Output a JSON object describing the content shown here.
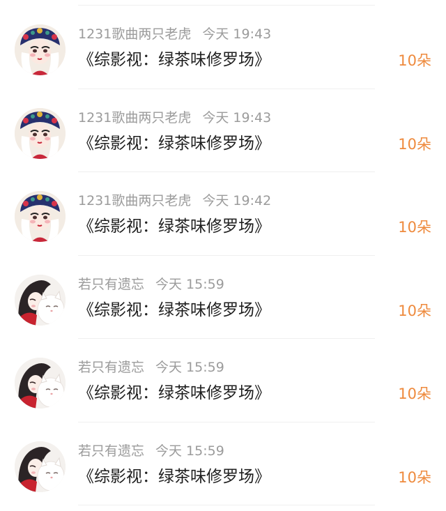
{
  "gift_records": [
    {
      "user": "1231歌曲两只老虎",
      "time": "今天 19:43",
      "title": "《综影视：绿茶味修罗场》",
      "amount": "10朵",
      "avatar_icon": "opera-face-avatar-icon"
    },
    {
      "user": "1231歌曲两只老虎",
      "time": "今天 19:43",
      "title": "《综影视：绿茶味修罗场》",
      "amount": "10朵",
      "avatar_icon": "opera-face-avatar-icon"
    },
    {
      "user": "1231歌曲两只老虎",
      "time": "今天 19:42",
      "title": "《综影视：绿茶味修罗场》",
      "amount": "10朵",
      "avatar_icon": "opera-face-avatar-icon"
    },
    {
      "user": "若只有遗忘",
      "time": "今天 15:59",
      "title": "《综影视：绿茶味修罗场》",
      "amount": "10朵",
      "avatar_icon": "girl-with-cat-avatar-icon"
    },
    {
      "user": "若只有遗忘",
      "time": "今天 15:59",
      "title": "《综影视：绿茶味修罗场》",
      "amount": "10朵",
      "avatar_icon": "girl-with-cat-avatar-icon"
    },
    {
      "user": "若只有遗忘",
      "time": "今天 15:59",
      "title": "《综影视：绿茶味修罗场》",
      "amount": "10朵",
      "avatar_icon": "girl-with-cat-avatar-icon"
    }
  ],
  "colors": {
    "username": "#9b9b9b",
    "title": "#1f1f1f",
    "amount": "#ee8a3d",
    "divider": "#efefef"
  }
}
